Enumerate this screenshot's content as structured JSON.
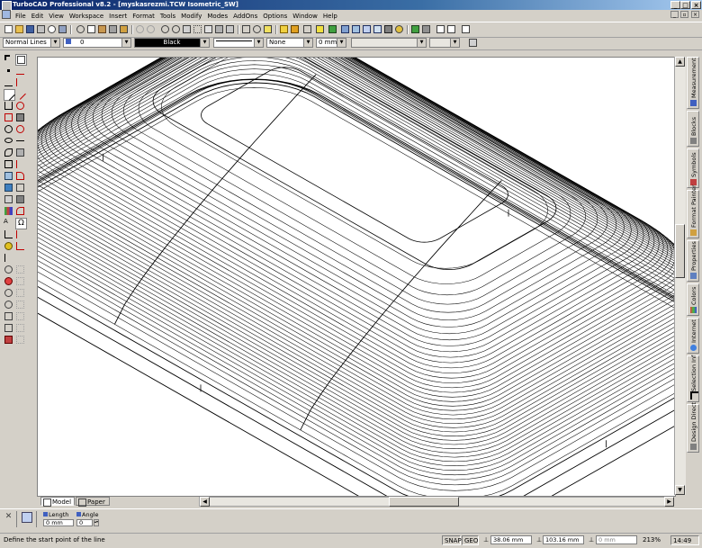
{
  "window": {
    "title": "TurboCAD Professional v8.2 - [myskasrezmi.TCW Isometric_SW]",
    "buttons": {
      "minimize": "_",
      "maximize": "□",
      "close": "×"
    }
  },
  "menu": [
    "File",
    "Edit",
    "View",
    "Workspace",
    "Insert",
    "Format",
    "Tools",
    "Modify",
    "Modes",
    "AddOns",
    "Options",
    "Window",
    "Help"
  ],
  "property_bar": {
    "line_style": "Normal Lines",
    "layer_value": "0",
    "color": "Black",
    "pen_color_hex": "#000000",
    "fill": "None",
    "width": "0 mm"
  },
  "tabs": [
    {
      "label": "Model"
    },
    {
      "label": "Paper"
    }
  ],
  "side_tabs": [
    "Measurement",
    "Blocks",
    "Symbols",
    "Format Painter",
    "Properties",
    "Colors",
    "Internet",
    "Selection Inf",
    "Design Direct"
  ],
  "inspector": {
    "length_label": "Length",
    "length_value": "0 mm",
    "angle_label": "Angle",
    "angle_value": "0"
  },
  "status": {
    "prompt": "Define the start point of the line",
    "snap": "SNAP",
    "geo": "GEO",
    "x": "38.06 mm",
    "y": "103.16 mm",
    "z": "0 mm",
    "zoom": "213%",
    "time": "14:49"
  }
}
